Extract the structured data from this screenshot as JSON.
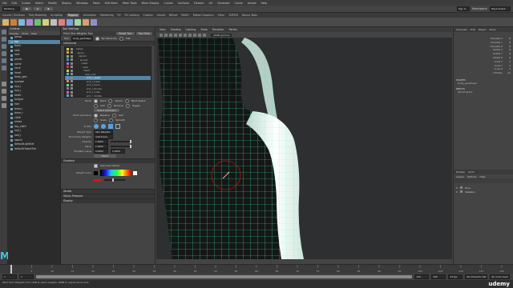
{
  "app": {
    "menus": [
      "File",
      "Edit",
      "Create",
      "Select",
      "Modify",
      "Display",
      "Windows",
      "Mesh",
      "Edit Mesh",
      "Mesh Tools",
      "Mesh Display",
      "Curves",
      "Surfaces",
      "Deform",
      "UV",
      "Generate",
      "Cache",
      "Arnold",
      "Help"
    ],
    "workspace_label": "Workspace:",
    "workspace_value": "Maya Classic",
    "menu_set": "Modeling",
    "signin": "Sign In"
  },
  "shelf": {
    "tabs": [
      "Curves / Surfaces",
      "Poly Modeling",
      "Sculpting",
      "Rigging",
      "Animation",
      "Rendering",
      "FX",
      "FX Caching",
      "Custom",
      "Arnold",
      "Bifrost",
      "MASH",
      "Motion Graphics",
      "XGen",
      "TURTLE",
      "Bonus Tools"
    ],
    "active_tab": "Rigging",
    "icon_colors": [
      "#d9b36a",
      "#c97f3d",
      "#7fb8d8",
      "#b088d0",
      "#6ec06e",
      "#d2d27a",
      "#c0c0c0",
      "#e08080",
      "#7fa0d8",
      "#a0d8a0",
      "#d8a070",
      "#9090d0"
    ]
  },
  "outliner": {
    "title": "Outliner",
    "menu": [
      "Display",
      "Show",
      "Help"
    ],
    "items": [
      {
        "label": "persp",
        "selected": false
      },
      {
        "label": "top",
        "selected": true
      },
      {
        "label": "front",
        "selected": false
      },
      {
        "label": "side",
        "selected": false
      },
      {
        "label": "root",
        "selected": false
      },
      {
        "label": "pelvis",
        "selected": false
      },
      {
        "label": "spine",
        "selected": false
      },
      {
        "label": "neck",
        "selected": false
      },
      {
        "label": "head",
        "selected": false
      },
      {
        "label": "body_geo",
        "selected": false
      },
      {
        "label": "eyelash",
        "selected": false
      },
      {
        "label": "eye_l",
        "selected": false
      },
      {
        "label": "eye_r",
        "selected": false
      },
      {
        "label": "teeth",
        "selected": false
      },
      {
        "label": "tongue",
        "selected": false
      },
      {
        "label": "hair",
        "selected": false
      },
      {
        "label": "brow_l",
        "selected": false
      },
      {
        "label": "brow_r",
        "selected": false
      },
      {
        "label": "cloth",
        "selected": false
      },
      {
        "label": "shoes",
        "selected": false
      },
      {
        "label": "top_cloth",
        "selected": false
      },
      {
        "label": "nail_l",
        "selected": false
      },
      {
        "label": "nail_r",
        "selected": false
      },
      {
        "label": "sword",
        "selected": false
      },
      {
        "label": "defaultLightSet",
        "selected": false
      },
      {
        "label": "defaultObjectSet",
        "selected": false
      }
    ]
  },
  "tool_settings": {
    "title": "Tool Settings",
    "tool_name": "Paint Skin Weights Tool",
    "reset_label": "Reset Tool",
    "help_label": "Tool Help",
    "skin_label": "Skin",
    "skin_value": "body_geoShape",
    "skin_options": [
      "By Hierarchy",
      "Flat"
    ],
    "influences_header": "Influences",
    "influences": [
      {
        "label": "pelvis",
        "color": "#f0c040",
        "selected": false
      },
      {
        "label": "spine",
        "color": "#e0a030",
        "selected": false
      },
      {
        "label": "spine1",
        "color": "#70c070",
        "selected": false
      },
      {
        "label": "spine2",
        "color": "#5090d0",
        "selected": false
      },
      {
        "label": "chest",
        "color": "#c070c0",
        "selected": false
      },
      {
        "label": "neck",
        "color": "#c04040",
        "selected": false
      },
      {
        "label": "head",
        "color": "#d0d040",
        "selected": false
      },
      {
        "label": "hair_root",
        "color": "#40c0c0",
        "selected": false
      },
      {
        "label": "arm_l_upper",
        "color": "#8080e0",
        "selected": true
      },
      {
        "label": "arm_l_lower",
        "color": "#e08060",
        "selected": false
      },
      {
        "label": "arm_l_hand",
        "color": "#60e080",
        "selected": false
      },
      {
        "label": "arm_l_thumb",
        "color": "#a060e0",
        "selected": false
      },
      {
        "label": "arm_l_index",
        "color": "#e060a0",
        "selected": false
      },
      {
        "label": "arm_l_middle",
        "color": "#60a0e0",
        "selected": false
      },
      {
        "label": "arm_l_ring",
        "color": "#a0e060",
        "selected": false
      },
      {
        "label": "arm_l_pinky",
        "color": "#e0e060",
        "selected": false
      }
    ],
    "mode_label": "Mode",
    "modes": [
      "Paint",
      "Select",
      "Paint Select"
    ],
    "mode_selected": 0,
    "add_remove_labels": [
      "Add",
      "Remove",
      "Toggle"
    ],
    "select_geometry": "Select Geometry",
    "paint_operation_label": "Paint operation",
    "paint_ops": [
      "Replace",
      "Add",
      "Scale",
      "Smooth"
    ],
    "profile_label": "Profile",
    "weight_type_label": "Weight Type",
    "weight_type_value": "Skin Weights",
    "normalize_label": "Normalize Weights",
    "normalize_value": "Interactive",
    "opacity_label": "Opacity",
    "opacity_value": "1.0000",
    "value_label": "Value",
    "value_value": "1.0000",
    "minmax_label": "Min/Max value",
    "min_value": "0.0000",
    "max_value": "1.0000",
    "flood_label": "Flood",
    "gradient_header": "Gradient",
    "use_color_ramp": "Use Color Ramp",
    "weight_color_label": "Weight Color",
    "collapsed_sections": [
      "Stroke",
      "Stylus Pressure",
      "Display"
    ]
  },
  "viewport": {
    "menus": [
      "View",
      "Shading",
      "Lighting",
      "Show",
      "Renderer",
      "Panels"
    ],
    "camera": "persp",
    "color_space": "sRGB gamma"
  },
  "channel_box": {
    "tabs": [
      "Channels",
      "Edit",
      "Object",
      "Show"
    ],
    "attributes": [
      {
        "name": "Translate X",
        "value": "0"
      },
      {
        "name": "Translate Y",
        "value": "0"
      },
      {
        "name": "Translate Z",
        "value": "0"
      },
      {
        "name": "Rotate X",
        "value": "0"
      },
      {
        "name": "Rotate Y",
        "value": "0"
      },
      {
        "name": "Rotate Z",
        "value": "0"
      },
      {
        "name": "Scale X",
        "value": "1"
      },
      {
        "name": "Scale Y",
        "value": "1"
      },
      {
        "name": "Scale Z",
        "value": "1"
      },
      {
        "name": "Visibility",
        "value": "on"
      }
    ],
    "shapes_label": "SHAPES",
    "shape_name": "body_geoShape",
    "inputs_label": "INPUTS",
    "input_name": "skinCluster1"
  },
  "layer_editor": {
    "tabs": [
      "Display",
      "Anim"
    ],
    "menu": [
      "Layers",
      "Options",
      "Help"
    ],
    "layers": [
      {
        "vis": "V",
        "name": "Face"
      },
      {
        "vis": "V",
        "name": "Skeleton"
      }
    ]
  },
  "timeline": {
    "ticks": [
      "1",
      "5",
      "10",
      "15",
      "20",
      "25",
      "30",
      "35",
      "40",
      "45",
      "50",
      "55",
      "60",
      "65",
      "70",
      "75",
      "80",
      "85",
      "90",
      "95",
      "100",
      "105",
      "110",
      "115",
      "120"
    ],
    "start": "1",
    "end": "120",
    "range_start": "1",
    "range_end": "120",
    "playback_end": "200",
    "fps": "24 fps",
    "char_set": "No Character Set",
    "anim_layer": "No Anim Layer"
  },
  "help_line": "Paint Skin Weights Tool: LMB to paint weights, MMB to adjust brush size.",
  "watermark": "udemy",
  "colors": {
    "accent": "#5285a6",
    "wire": "#3df0b0",
    "bg_viewport": "#2d2f31"
  }
}
